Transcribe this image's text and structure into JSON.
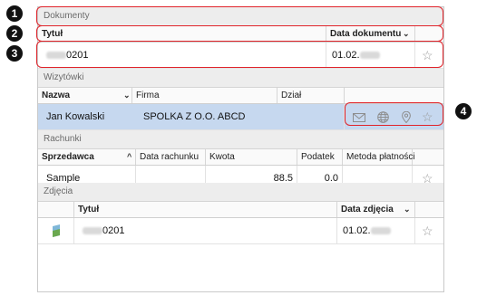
{
  "documents": {
    "section_title": "Dokumenty",
    "col_title": "Tytuł",
    "col_date": "Data dokumentu",
    "row": {
      "title_suffix": "0201",
      "date_prefix": "01.02."
    }
  },
  "business_cards": {
    "section_title": "Wizytówki",
    "col_name": "Nazwa",
    "col_company": "Firma",
    "col_department": "Dział",
    "row": {
      "name": "Jan Kowalski",
      "company": "SPOLKA Z O.O. ABCD",
      "department": ""
    }
  },
  "invoices": {
    "section_title": "Rachunki",
    "col_seller": "Sprzedawca",
    "col_date": "Data rachunku",
    "col_amount": "Kwota",
    "col_tax": "Podatek",
    "col_payment": "Metoda płatności",
    "row": {
      "seller": "Sample",
      "date": "",
      "amount": "88.5",
      "tax": "0.0",
      "payment": ""
    }
  },
  "photos": {
    "section_title": "Zdjęcia",
    "col_title": "Tytuł",
    "col_date": "Data zdjęcia",
    "row": {
      "title_suffix": "0201",
      "date_prefix": "01.02."
    }
  },
  "callouts": [
    "1",
    "2",
    "3",
    "4"
  ],
  "icons": [
    "envelope-icon",
    "globe-icon",
    "location-pin-icon",
    "star-icon"
  ],
  "colors": {
    "callout": "#e0242b",
    "selection": "#c6d8ef"
  }
}
